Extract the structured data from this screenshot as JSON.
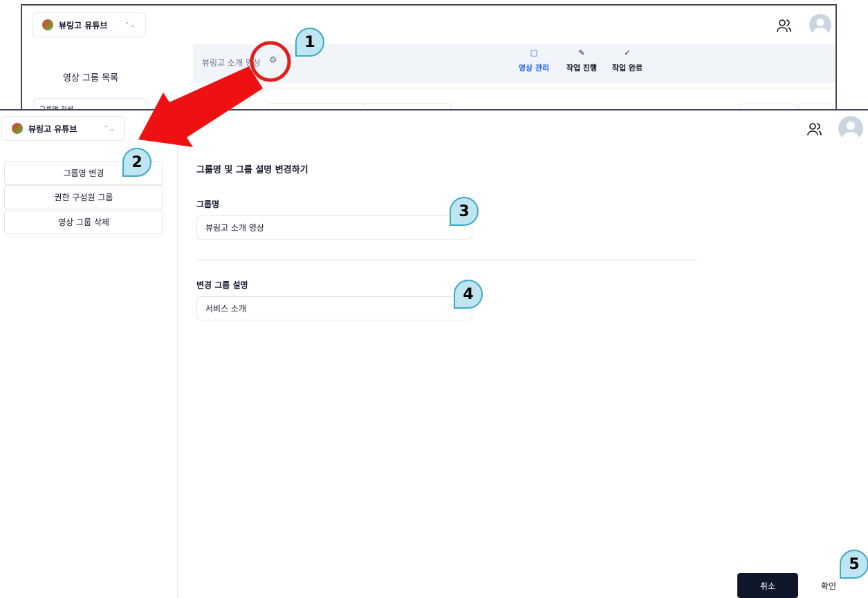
{
  "workspace": {
    "name": "뷰링고 유튜브"
  },
  "inset": {
    "sidebar_title": "영상 그룹 목록",
    "search_partial": "그룹명 검색",
    "group_title": "뷰링고 소개 영상",
    "tabs": [
      {
        "label": "영상 관리",
        "icon": "□",
        "active": true
      },
      {
        "label": "작업 진행",
        "icon": "✎",
        "active": false
      },
      {
        "label": "작업 완료",
        "icon": "✓",
        "active": false
      }
    ]
  },
  "sidebar": {
    "items": [
      {
        "label": "그룹명 변경"
      },
      {
        "label": "권한 구성원 그룹"
      },
      {
        "label": "영상 그룹 삭제"
      }
    ]
  },
  "form": {
    "heading": "그룹명 및 그룹 설명 변경하기",
    "name_label": "그룹명",
    "name_value": "뷰링고 소개 영상",
    "desc_label": "변경 그룹 설명",
    "desc_value": "서비스 소개"
  },
  "footer": {
    "cancel": "취소",
    "confirm": "확인"
  },
  "badges": [
    "1",
    "2",
    "3",
    "4",
    "5"
  ],
  "colors": {
    "accent": "#2563eb",
    "primary_button": "#0f172a",
    "badge_fill": "#bfe6f0",
    "badge_border": "#3aa9c8",
    "arrow": "#ee1111",
    "highlight_circle": "#e11d1d"
  }
}
